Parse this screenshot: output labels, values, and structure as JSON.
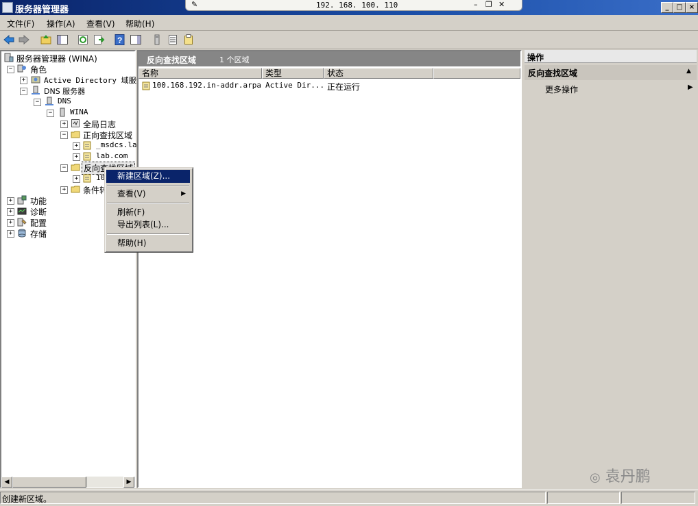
{
  "window": {
    "title": "服务器管理器",
    "remote_host": "192. 168. 100. 110"
  },
  "menu": [
    "文件(F)",
    "操作(A)",
    "查看(V)",
    "帮助(H)"
  ],
  "tree": {
    "root": "服务器管理器 (WINA)",
    "roles": "角色",
    "ad": "Active Directory 域服务",
    "dns_server": "DNS 服务器",
    "dns": "DNS",
    "wina": "WINA",
    "global_logs": "全局日志",
    "forward_zones": "正向查找区域",
    "msdcs": "_msdcs.la",
    "labcom": "lab.com",
    "reverse_zones": "反向查找区域",
    "reverse_child": "10",
    "conditional": "条件转",
    "features": "功能",
    "diagnostics": "诊断",
    "configuration": "配置",
    "storage": "存储"
  },
  "content": {
    "title": "反向查找区域",
    "count": "1 个区域",
    "columns": [
      "名称",
      "类型",
      "状态"
    ],
    "rows": [
      {
        "name": "100.168.192.in-addr.arpa",
        "type": "Active Dir...",
        "status": "正在运行"
      }
    ]
  },
  "context_menu": {
    "new_zone": "新建区域(Z)...",
    "view": "查看(V)",
    "refresh": "刷新(F)",
    "export": "导出列表(L)...",
    "help": "帮助(H)"
  },
  "actions": {
    "header": "操作",
    "section": "反向查找区域",
    "more": "更多操作"
  },
  "status": "创建新区域。",
  "watermark": "袁丹鹏"
}
